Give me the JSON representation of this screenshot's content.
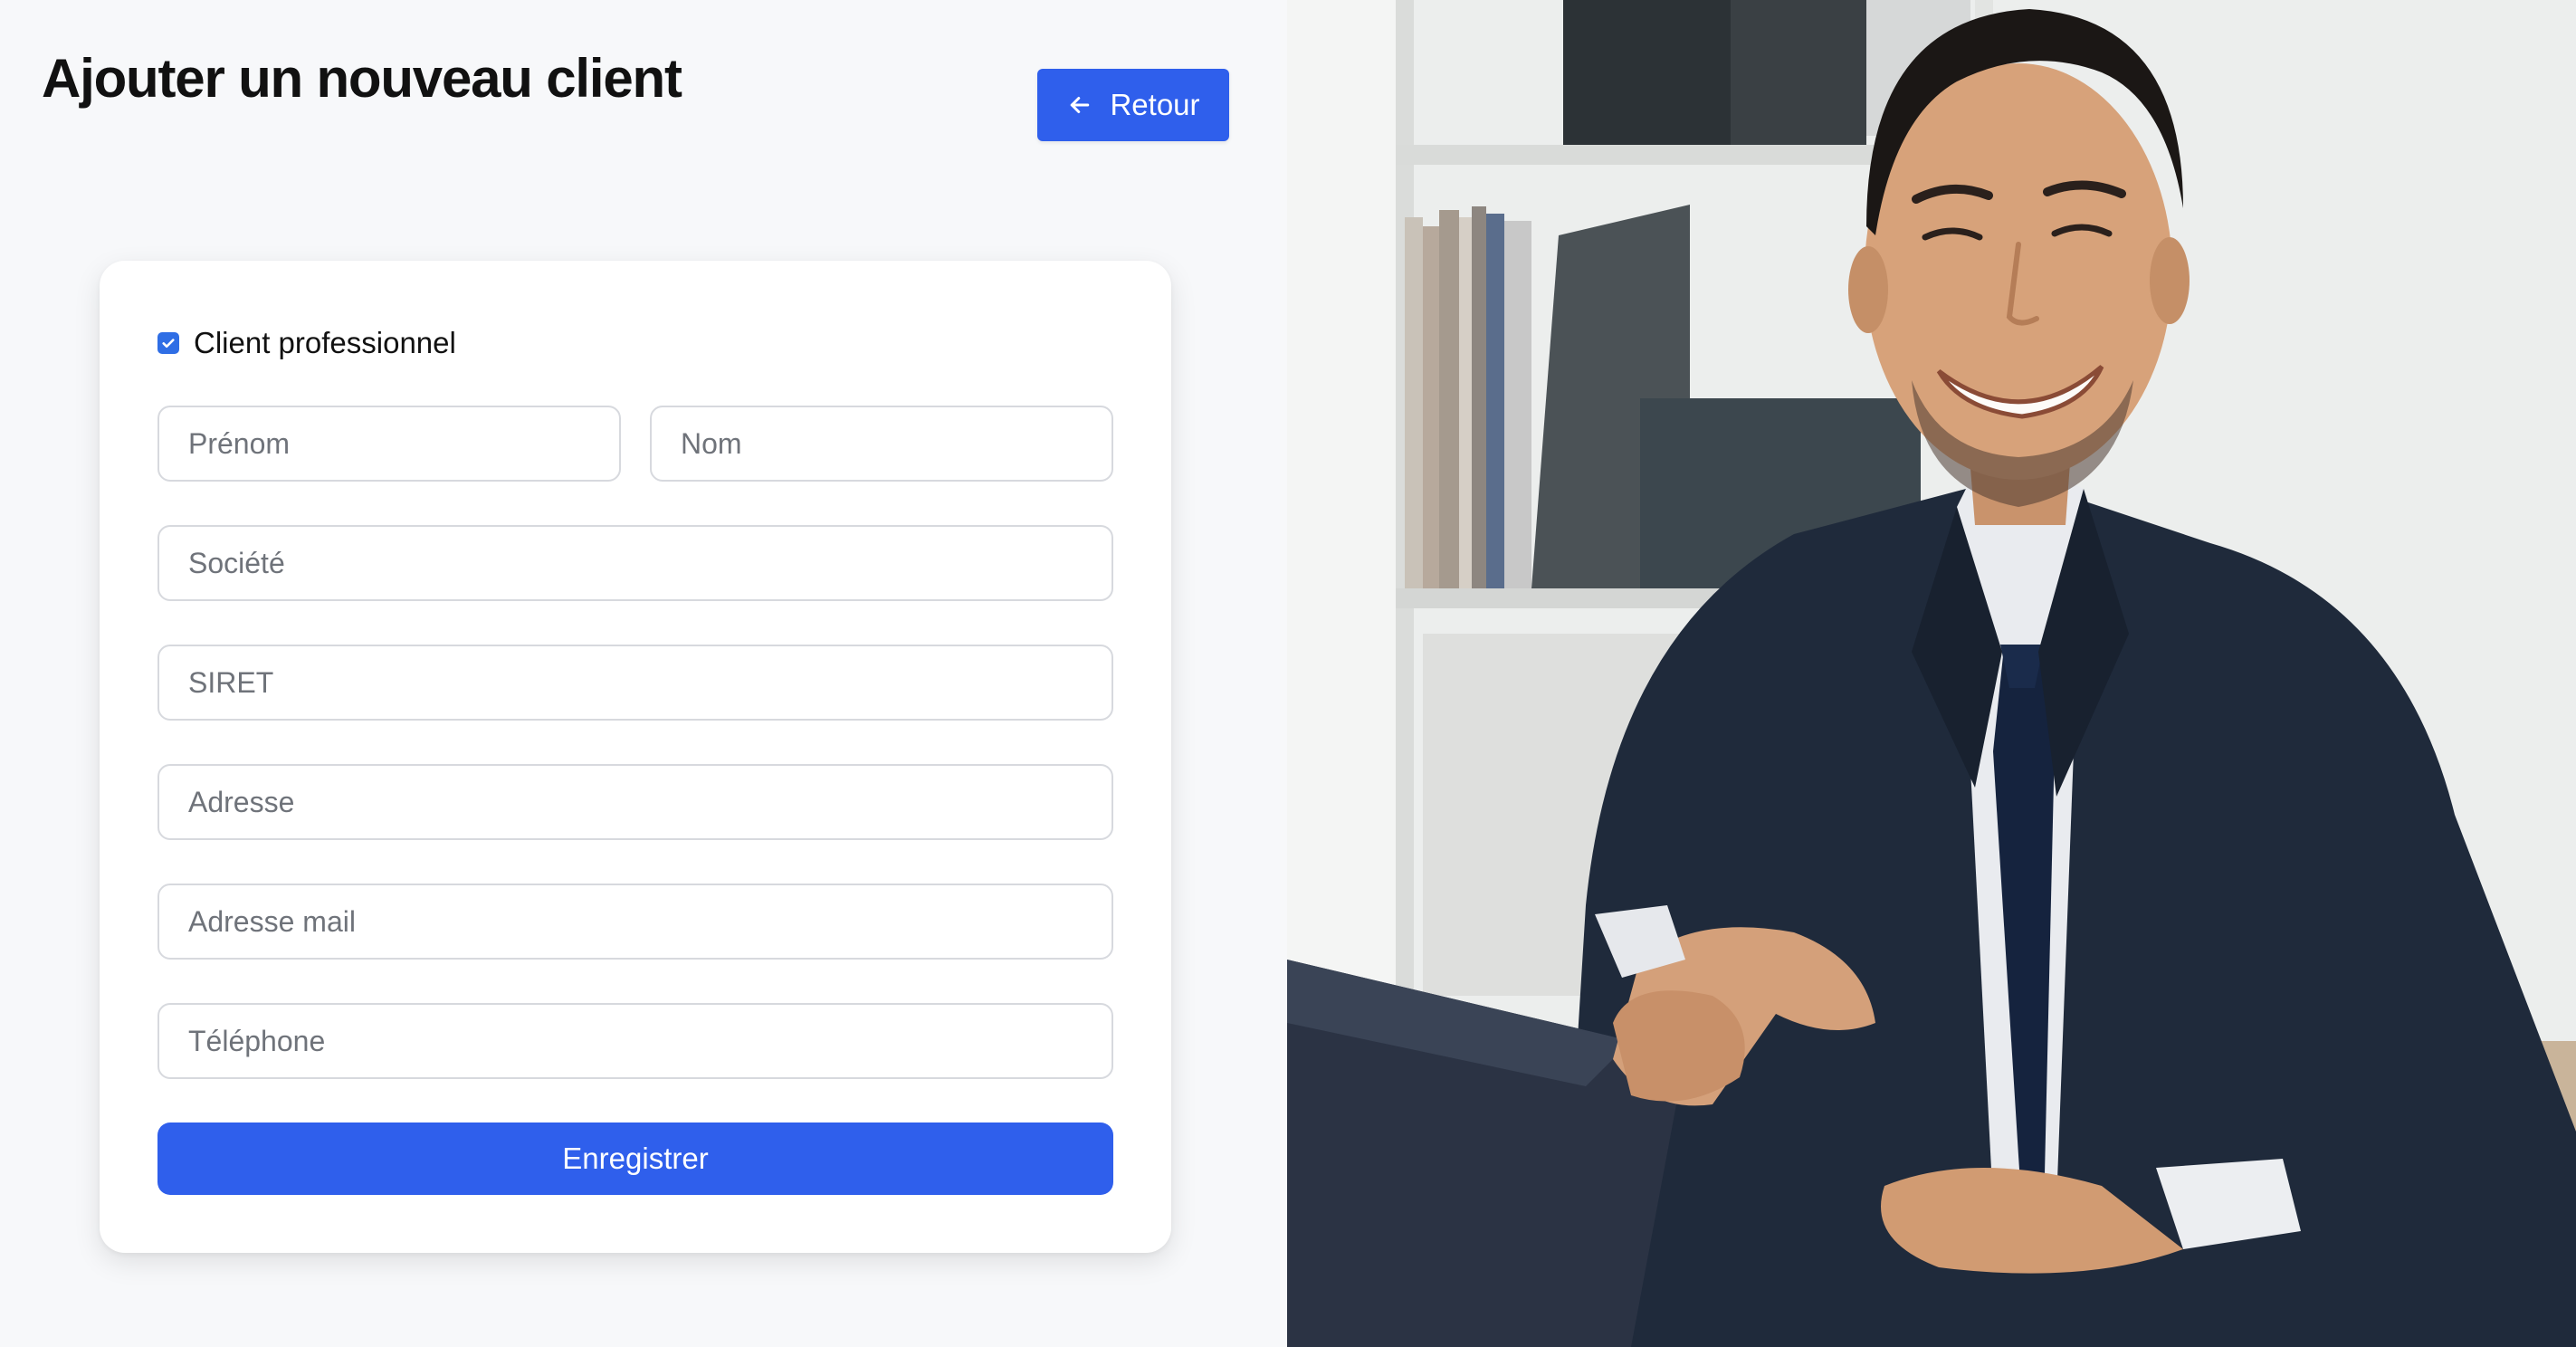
{
  "page": {
    "title": "Ajouter un nouveau client"
  },
  "header": {
    "back_label": "Retour",
    "back_icon": "arrow-left-icon"
  },
  "form": {
    "professional_checkbox": {
      "label": "Client professionnel",
      "checked": true
    },
    "fields": {
      "prenom": {
        "placeholder": "Prénom",
        "value": ""
      },
      "nom": {
        "placeholder": "Nom",
        "value": ""
      },
      "societe": {
        "placeholder": "Société",
        "value": ""
      },
      "siret": {
        "placeholder": "SIRET",
        "value": ""
      },
      "adresse": {
        "placeholder": "Adresse",
        "value": ""
      },
      "mail": {
        "placeholder": "Adresse mail",
        "value": ""
      },
      "telephone": {
        "placeholder": "Téléphone",
        "value": ""
      }
    },
    "submit_label": "Enregistrer"
  },
  "hero_image": {
    "subject": "smiling-businessman-handshake-photo"
  },
  "colors": {
    "accent": "#2f5fec",
    "checkbox": "#2f6ee5",
    "page_bg": "#f7f8fa",
    "card_bg": "#ffffff"
  }
}
